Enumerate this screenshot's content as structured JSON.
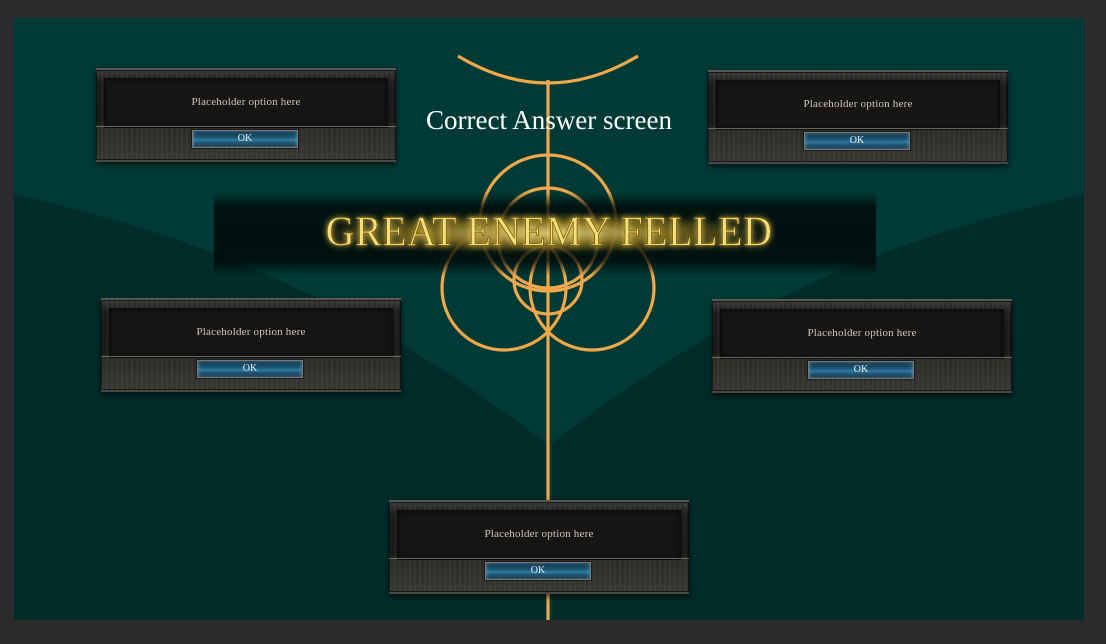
{
  "screen": {
    "title": "Correct Answer screen",
    "banner_text": "GREAT ENEMY FELLED"
  },
  "options": [
    {
      "text": "Placeholder option here",
      "button_label": "OK"
    },
    {
      "text": "Placeholder option here",
      "button_label": "OK"
    },
    {
      "text": "Placeholder option here",
      "button_label": "OK"
    },
    {
      "text": "Placeholder option here",
      "button_label": "OK"
    },
    {
      "text": "Placeholder option here",
      "button_label": "OK"
    }
  ],
  "colors": {
    "background": "#003a36",
    "dark_wedge": "#012c29",
    "sigil": "#f0a84a",
    "banner_text": "#f5df7c",
    "ok_button": "#1f5d7f"
  },
  "icons": {
    "emblem": "elden-ring-sigil-icon"
  }
}
